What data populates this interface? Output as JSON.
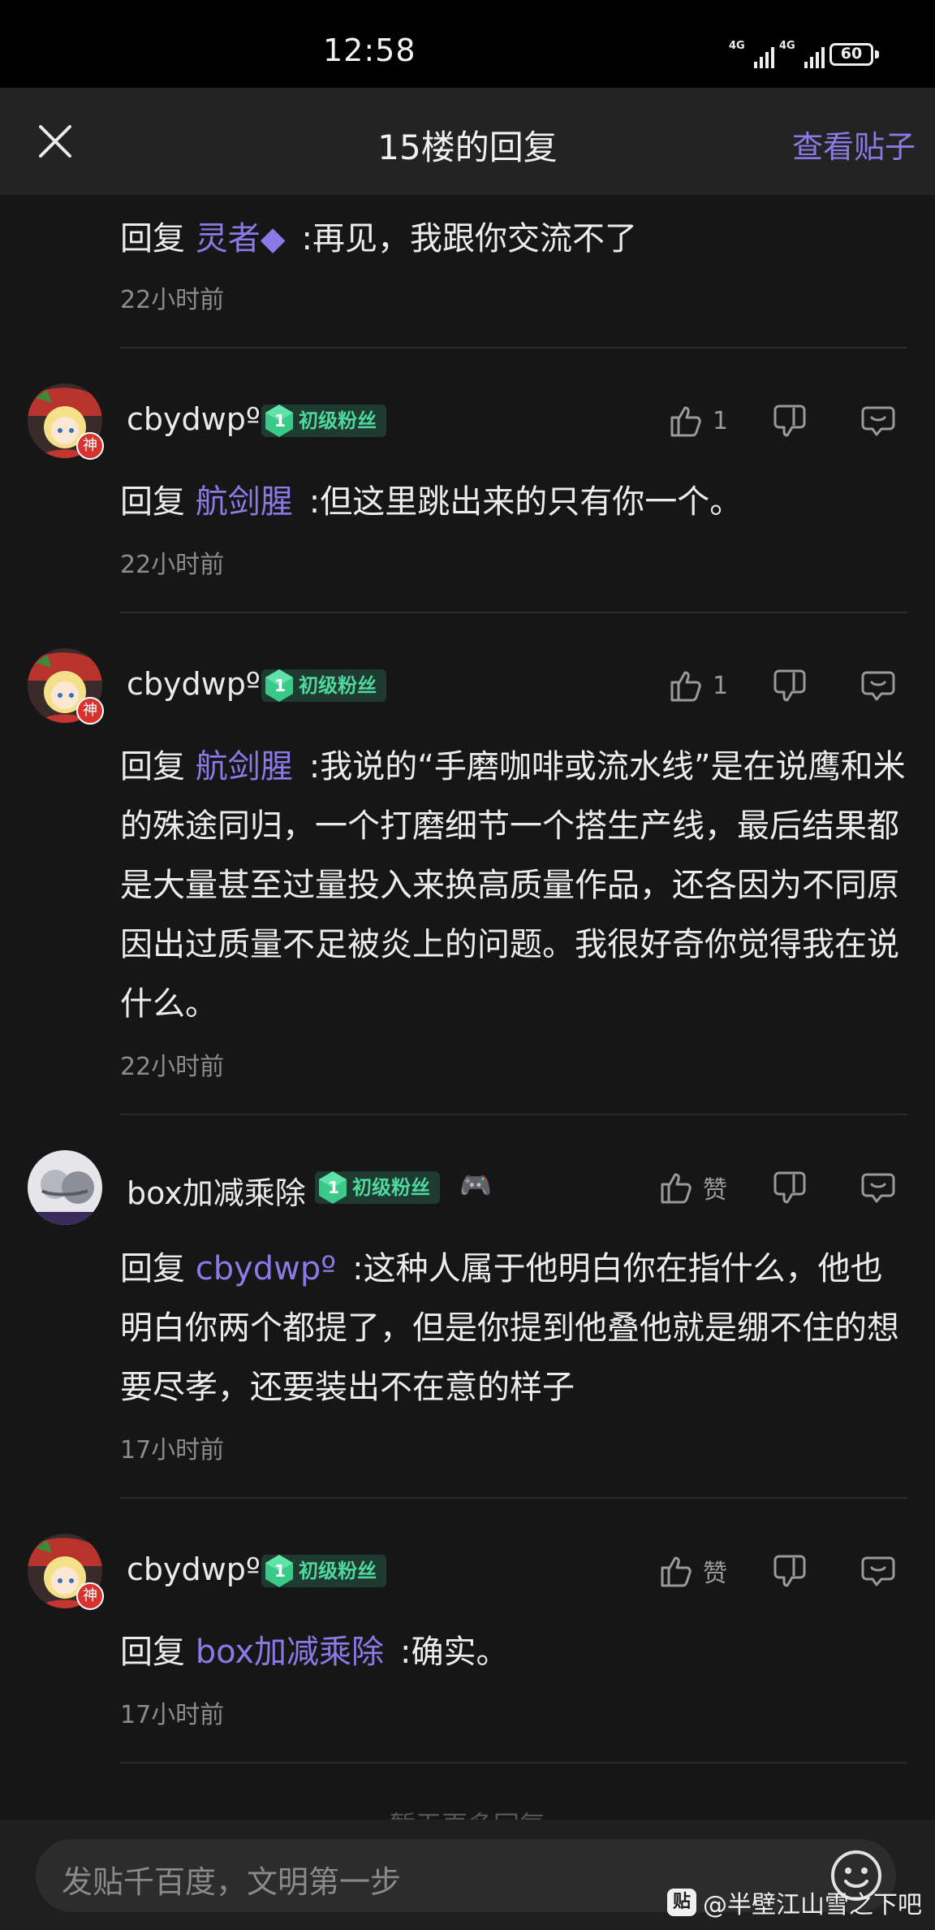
{
  "status": {
    "time": "12:58",
    "signal1": "4G",
    "signal2": "4G",
    "battery": "60"
  },
  "header": {
    "title": "15楼的回复",
    "view_post": "查看贴子"
  },
  "replies": [
    {
      "reply_prefix": "回复",
      "reply_to": "灵者◆",
      "text": ":再见，我跟你交流不了",
      "time": "22小时前"
    },
    {
      "username": "cbydwpº",
      "badge_level": "1",
      "badge_label": "初级粉丝",
      "god": "神",
      "like_count": "1",
      "reply_prefix": "回复",
      "reply_to": "航剑腥",
      "text": ":但这里跳出来的只有你一个。",
      "time": "22小时前"
    },
    {
      "username": "cbydwpº",
      "badge_level": "1",
      "badge_label": "初级粉丝",
      "god": "神",
      "like_count": "1",
      "reply_prefix": "回复",
      "reply_to": "航剑腥",
      "text": ":我说的“手磨咖啡或流水线”是在说鹰和米的殊途同归，一个打磨细节一个搭生产线，最后结果都是大量甚至过量投入来换高质量作品，还各因为不同原因出过质量不足被炎上的问题。我很好奇你觉得我在说什么。",
      "time": "22小时前"
    },
    {
      "username": "box加减乘除",
      "badge_level": "1",
      "badge_label": "初级粉丝",
      "game_icon": "🎮",
      "like_count": "赞",
      "reply_prefix": "回复",
      "reply_to": "cbydwpº",
      "text": ":这种人属于他明白你在指什么，他也明白你两个都提了，但是你提到他叠他就是绷不住的想要尽孝，还要装出不在意的样子",
      "time": "17小时前"
    },
    {
      "username": "cbydwpº",
      "badge_level": "1",
      "badge_label": "初级粉丝",
      "god": "神",
      "like_count": "赞",
      "reply_prefix": "回复",
      "reply_to": "box加减乘除",
      "text": ":确实。",
      "time": "17小时前"
    }
  ],
  "more_replies": "暂无更多回复",
  "bottom": {
    "placeholder": "发贴千百度，文明第一步",
    "watermark_icon": "贴",
    "watermark": "@半壁江山雪之下吧"
  },
  "icons": [
    "close-icon",
    "thumbs-up-icon",
    "thumbs-down-icon",
    "comment-icon",
    "smiley-icon",
    "gem-icon",
    "gamepad-icon"
  ],
  "colors": {
    "accent": "#8b7ae6",
    "badge_green": "#4fd89d",
    "background": "#161616"
  }
}
